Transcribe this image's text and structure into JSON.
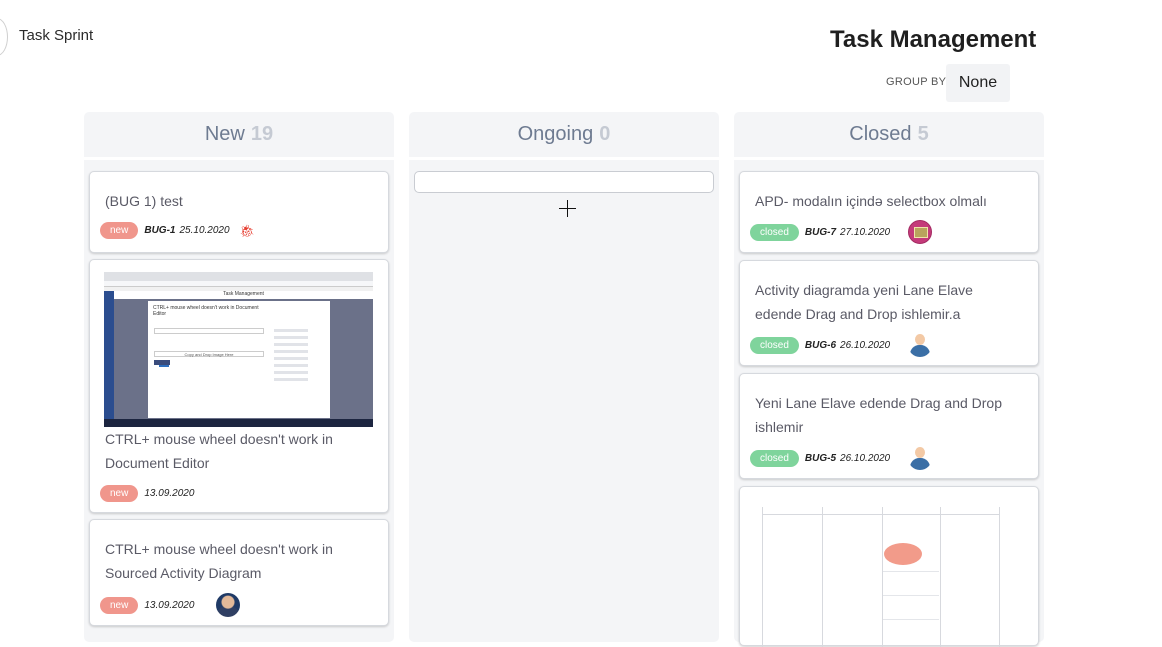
{
  "header": {
    "app_title": "Task Sprint",
    "page_title": "Task Management",
    "group_by_label": "GROUP BY",
    "group_by_value": "None"
  },
  "columns": [
    {
      "name": "New",
      "count": "19"
    },
    {
      "name": "Ongoing",
      "count": "0"
    },
    {
      "name": "Closed",
      "count": "5"
    }
  ],
  "new_cards": [
    {
      "title": "(BUG 1) test",
      "status": "new",
      "bug_id": "BUG-1",
      "date": "25.10.2020",
      "icon": "bug-icon"
    },
    {
      "title": "CTRL+ mouse wheel doesn't work in Document Editor",
      "status": "new",
      "date": "13.09.2020",
      "thumbnail": {
        "app_header": "Task Management",
        "modal_title": "CTRL+ mouse wheel doesn't work in Document Editor",
        "dropdown_text": "Copy and Drop Image Here"
      }
    },
    {
      "title": "CTRL+ mouse wheel doesn't work in Sourced Activity Diagram",
      "status": "new",
      "date": "13.09.2020",
      "avatar": "photo-avatar"
    }
  ],
  "closed_cards": [
    {
      "title": "APD- modalın içində selectbox olmalı",
      "status": "closed",
      "bug_id": "BUG-7",
      "date": "27.10.2020",
      "avatar": "pink-avatar"
    },
    {
      "title": "Activity diagramda yeni Lane Elave edende Drag and Drop ishlemir.a",
      "status": "closed",
      "bug_id": "BUG-6",
      "date": "26.10.2020",
      "avatar": "user-avatar"
    },
    {
      "title": "Yeni Lane Elave edende Drag and Drop ishlemir",
      "status": "closed",
      "bug_id": "BUG-5",
      "date": "26.10.2020",
      "avatar": "user-avatar"
    }
  ],
  "colors": {
    "column_bg": "#f4f5f7",
    "badge_new": "#f0968c",
    "badge_closed": "#7fd49c",
    "header_text": "#6e7b91"
  }
}
